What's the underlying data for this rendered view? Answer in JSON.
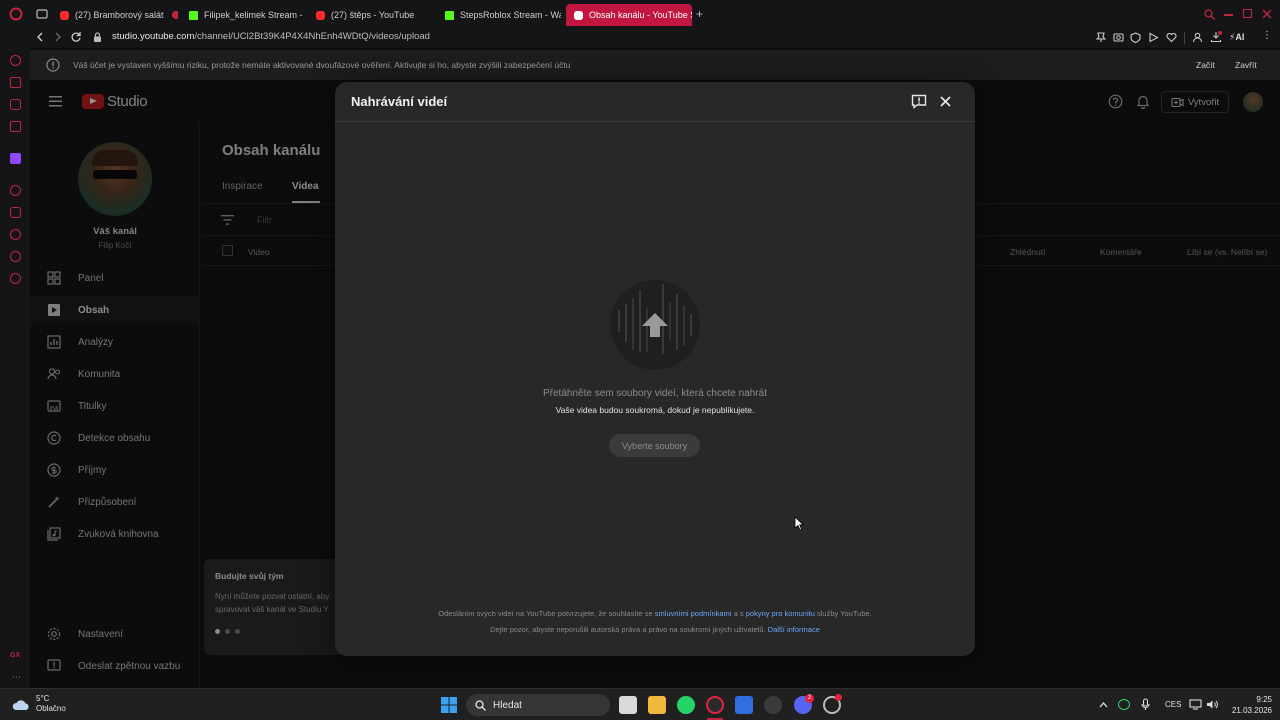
{
  "browser": {
    "tabs": [
      {
        "title": "(27) Bramborový salát",
        "favicon": "youtube-icon",
        "active": false
      },
      {
        "title": "Filipek_kelimek Stream - V",
        "favicon": "kick-icon",
        "active": false
      },
      {
        "title": "(27) štěps - YouTube",
        "favicon": "youtube-icon",
        "active": false
      },
      {
        "title": "StepsRoblox Stream - Wa",
        "favicon": "kick-icon",
        "active": false
      },
      {
        "title": "Obsah kanálu - YouTube S",
        "favicon": "youtube-icon",
        "active": true
      }
    ],
    "url_host": "studio.youtube.com",
    "url_path": "/channel/UCl2Bt39K4P4X4NhEnh4WDtQ/videos/upload",
    "accent": "#c0163f"
  },
  "banner": {
    "text": "Váš účet je vystaven vyššímu riziku, protože nemáte aktivované dvoufázové ověření. Aktivujte si ho, abyste zvýšili zabezpečení účtu",
    "start": "Začít",
    "close": "Zavřít"
  },
  "studio": {
    "logo_text": "Studio",
    "create_label": "Vytvořit",
    "channel_title": "Váš kanál",
    "channel_handle": "Filip Kočí",
    "nav": [
      {
        "label": "Panel",
        "icon": "dashboard-icon",
        "selected": false
      },
      {
        "label": "Obsah",
        "icon": "content-icon",
        "selected": true
      },
      {
        "label": "Analýzy",
        "icon": "analytics-icon",
        "selected": false
      },
      {
        "label": "Komunita",
        "icon": "community-icon",
        "selected": false
      },
      {
        "label": "Titulky",
        "icon": "subtitles-icon",
        "selected": false
      },
      {
        "label": "Detekce obsahu",
        "icon": "copyright-icon",
        "selected": false
      },
      {
        "label": "Příjmy",
        "icon": "earn-icon",
        "selected": false
      },
      {
        "label": "Přizpůsobení",
        "icon": "customization-icon",
        "selected": false
      },
      {
        "label": "Zvuková knihovna",
        "icon": "audio-library-icon",
        "selected": false
      }
    ],
    "nav_bottom": [
      {
        "label": "Nastavení",
        "icon": "gear-icon"
      },
      {
        "label": "Odeslat zpětnou vazbu",
        "icon": "feedback-icon"
      }
    ],
    "page_title": "Obsah kanálu",
    "tabs": [
      "Inspirace",
      "Videa"
    ],
    "filter_placeholder": "Filtr",
    "columns": [
      "Video",
      "Zhlédnutí",
      "Komentáře",
      "Líbí se (vs. Nelíbí se)"
    ],
    "team_card": {
      "title": "Budujte svůj tým",
      "line1": "Nyní můžete pozvat ostatní, aby",
      "line2": "spravovat váš kanál ve Studiu Y"
    }
  },
  "modal": {
    "title": "Nahrávání videí",
    "drop_primary": "Přetáhněte sem soubory videí, která chcete nahrát",
    "drop_secondary": "Vaše videa budou soukromá, dokud je nepublikujete.",
    "select_button": "Vyberte soubory",
    "legal1_a": "Odesláním svých videí na YouTube potvrzujete, že souhlasíte se",
    "legal1_link1": "smluvními podmínkami",
    "legal1_b": "a s",
    "legal1_link2": "pokyny pro komunitu",
    "legal1_c": "služby YouTube.",
    "legal2_a": "Dejte pozor, abyste neporušili autorská práva a právo na soukromí jiných uživatelů.",
    "legal2_link": "Další informace"
  },
  "taskbar": {
    "weather_temp": "5°C",
    "weather_desc": "Oblačno",
    "search_label": "Hledat",
    "lang": "CES",
    "time": "9:25",
    "date": "21.03.2026",
    "discord_badge": "2"
  }
}
